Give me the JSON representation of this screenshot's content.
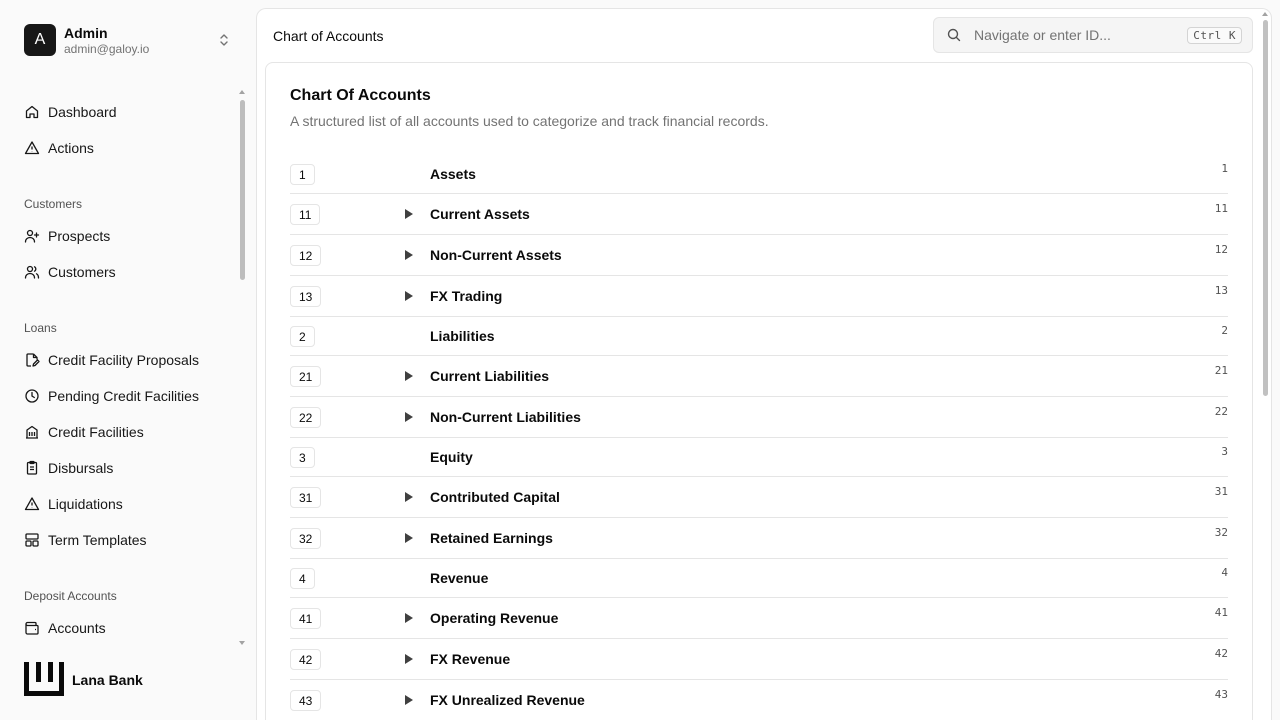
{
  "user": {
    "initial": "A",
    "name": "Admin",
    "email": "admin@galoy.io"
  },
  "nav": {
    "dashboard": "Dashboard",
    "actions": "Actions",
    "group_customers": "Customers",
    "prospects": "Prospects",
    "customers": "Customers",
    "group_loans": "Loans",
    "credit_facility_proposals": "Credit Facility Proposals",
    "pending_credit_facilities": "Pending Credit Facilities",
    "credit_facilities": "Credit Facilities",
    "disbursals": "Disbursals",
    "liquidations": "Liquidations",
    "term_templates": "Term Templates",
    "group_deposit_accounts": "Deposit Accounts",
    "accounts": "Accounts"
  },
  "brand": {
    "name": "Lana Bank"
  },
  "header": {
    "title": "Chart of Accounts"
  },
  "search": {
    "placeholder": "Navigate or enter ID...",
    "shortcut": "Ctrl K"
  },
  "card": {
    "title": "Chart Of Accounts",
    "description": "A structured list of all accounts used to categorize and track financial records."
  },
  "accounts": [
    {
      "code": "1",
      "name": "Assets",
      "expandable": false
    },
    {
      "code": "11",
      "name": "Current Assets",
      "expandable": true
    },
    {
      "code": "12",
      "name": "Non-Current Assets",
      "expandable": true
    },
    {
      "code": "13",
      "name": "FX Trading",
      "expandable": true
    },
    {
      "code": "2",
      "name": "Liabilities",
      "expandable": false
    },
    {
      "code": "21",
      "name": "Current Liabilities",
      "expandable": true
    },
    {
      "code": "22",
      "name": "Non-Current Liabilities",
      "expandable": true
    },
    {
      "code": "3",
      "name": "Equity",
      "expandable": false
    },
    {
      "code": "31",
      "name": "Contributed Capital",
      "expandable": true
    },
    {
      "code": "32",
      "name": "Retained Earnings",
      "expandable": true
    },
    {
      "code": "4",
      "name": "Revenue",
      "expandable": false
    },
    {
      "code": "41",
      "name": "Operating Revenue",
      "expandable": true
    },
    {
      "code": "42",
      "name": "FX Revenue",
      "expandable": true
    },
    {
      "code": "43",
      "name": "FX Unrealized Revenue",
      "expandable": true
    }
  ]
}
